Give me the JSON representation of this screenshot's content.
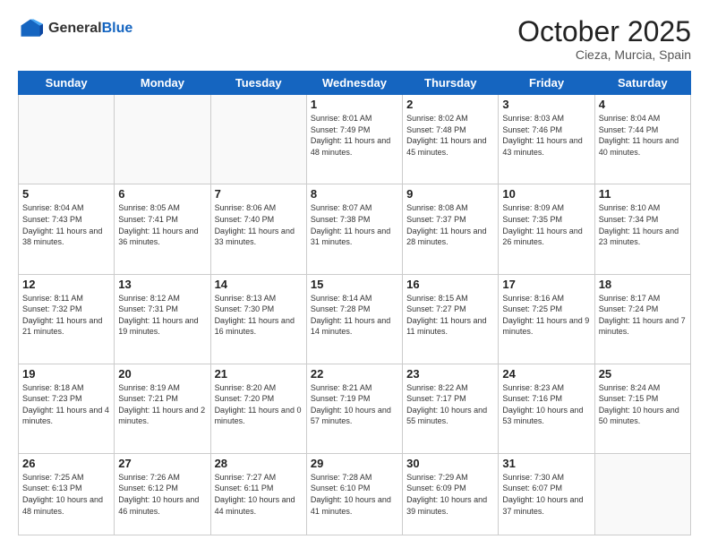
{
  "header": {
    "logo_general": "General",
    "logo_blue": "Blue",
    "month_title": "October 2025",
    "subtitle": "Cieza, Murcia, Spain"
  },
  "days_of_week": [
    "Sunday",
    "Monday",
    "Tuesday",
    "Wednesday",
    "Thursday",
    "Friday",
    "Saturday"
  ],
  "weeks": [
    [
      {
        "num": "",
        "info": ""
      },
      {
        "num": "",
        "info": ""
      },
      {
        "num": "",
        "info": ""
      },
      {
        "num": "1",
        "info": "Sunrise: 8:01 AM\nSunset: 7:49 PM\nDaylight: 11 hours and 48 minutes."
      },
      {
        "num": "2",
        "info": "Sunrise: 8:02 AM\nSunset: 7:48 PM\nDaylight: 11 hours and 45 minutes."
      },
      {
        "num": "3",
        "info": "Sunrise: 8:03 AM\nSunset: 7:46 PM\nDaylight: 11 hours and 43 minutes."
      },
      {
        "num": "4",
        "info": "Sunrise: 8:04 AM\nSunset: 7:44 PM\nDaylight: 11 hours and 40 minutes."
      }
    ],
    [
      {
        "num": "5",
        "info": "Sunrise: 8:04 AM\nSunset: 7:43 PM\nDaylight: 11 hours and 38 minutes."
      },
      {
        "num": "6",
        "info": "Sunrise: 8:05 AM\nSunset: 7:41 PM\nDaylight: 11 hours and 36 minutes."
      },
      {
        "num": "7",
        "info": "Sunrise: 8:06 AM\nSunset: 7:40 PM\nDaylight: 11 hours and 33 minutes."
      },
      {
        "num": "8",
        "info": "Sunrise: 8:07 AM\nSunset: 7:38 PM\nDaylight: 11 hours and 31 minutes."
      },
      {
        "num": "9",
        "info": "Sunrise: 8:08 AM\nSunset: 7:37 PM\nDaylight: 11 hours and 28 minutes."
      },
      {
        "num": "10",
        "info": "Sunrise: 8:09 AM\nSunset: 7:35 PM\nDaylight: 11 hours and 26 minutes."
      },
      {
        "num": "11",
        "info": "Sunrise: 8:10 AM\nSunset: 7:34 PM\nDaylight: 11 hours and 23 minutes."
      }
    ],
    [
      {
        "num": "12",
        "info": "Sunrise: 8:11 AM\nSunset: 7:32 PM\nDaylight: 11 hours and 21 minutes."
      },
      {
        "num": "13",
        "info": "Sunrise: 8:12 AM\nSunset: 7:31 PM\nDaylight: 11 hours and 19 minutes."
      },
      {
        "num": "14",
        "info": "Sunrise: 8:13 AM\nSunset: 7:30 PM\nDaylight: 11 hours and 16 minutes."
      },
      {
        "num": "15",
        "info": "Sunrise: 8:14 AM\nSunset: 7:28 PM\nDaylight: 11 hours and 14 minutes."
      },
      {
        "num": "16",
        "info": "Sunrise: 8:15 AM\nSunset: 7:27 PM\nDaylight: 11 hours and 11 minutes."
      },
      {
        "num": "17",
        "info": "Sunrise: 8:16 AM\nSunset: 7:25 PM\nDaylight: 11 hours and 9 minutes."
      },
      {
        "num": "18",
        "info": "Sunrise: 8:17 AM\nSunset: 7:24 PM\nDaylight: 11 hours and 7 minutes."
      }
    ],
    [
      {
        "num": "19",
        "info": "Sunrise: 8:18 AM\nSunset: 7:23 PM\nDaylight: 11 hours and 4 minutes."
      },
      {
        "num": "20",
        "info": "Sunrise: 8:19 AM\nSunset: 7:21 PM\nDaylight: 11 hours and 2 minutes."
      },
      {
        "num": "21",
        "info": "Sunrise: 8:20 AM\nSunset: 7:20 PM\nDaylight: 11 hours and 0 minutes."
      },
      {
        "num": "22",
        "info": "Sunrise: 8:21 AM\nSunset: 7:19 PM\nDaylight: 10 hours and 57 minutes."
      },
      {
        "num": "23",
        "info": "Sunrise: 8:22 AM\nSunset: 7:17 PM\nDaylight: 10 hours and 55 minutes."
      },
      {
        "num": "24",
        "info": "Sunrise: 8:23 AM\nSunset: 7:16 PM\nDaylight: 10 hours and 53 minutes."
      },
      {
        "num": "25",
        "info": "Sunrise: 8:24 AM\nSunset: 7:15 PM\nDaylight: 10 hours and 50 minutes."
      }
    ],
    [
      {
        "num": "26",
        "info": "Sunrise: 7:25 AM\nSunset: 6:13 PM\nDaylight: 10 hours and 48 minutes."
      },
      {
        "num": "27",
        "info": "Sunrise: 7:26 AM\nSunset: 6:12 PM\nDaylight: 10 hours and 46 minutes."
      },
      {
        "num": "28",
        "info": "Sunrise: 7:27 AM\nSunset: 6:11 PM\nDaylight: 10 hours and 44 minutes."
      },
      {
        "num": "29",
        "info": "Sunrise: 7:28 AM\nSunset: 6:10 PM\nDaylight: 10 hours and 41 minutes."
      },
      {
        "num": "30",
        "info": "Sunrise: 7:29 AM\nSunset: 6:09 PM\nDaylight: 10 hours and 39 minutes."
      },
      {
        "num": "31",
        "info": "Sunrise: 7:30 AM\nSunset: 6:07 PM\nDaylight: 10 hours and 37 minutes."
      },
      {
        "num": "",
        "info": ""
      }
    ]
  ]
}
